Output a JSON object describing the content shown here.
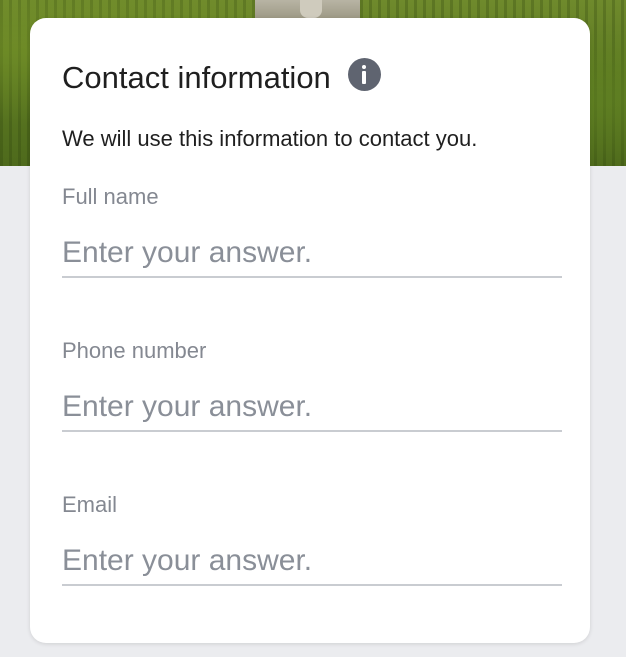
{
  "form": {
    "section_title": "Contact information",
    "info_icon": "info-icon",
    "description": "We will use this information to contact you.",
    "fields": [
      {
        "label": "Full name",
        "placeholder": "Enter your answer.",
        "value": ""
      },
      {
        "label": "Phone number",
        "placeholder": "Enter your answer.",
        "value": ""
      },
      {
        "label": "Email",
        "placeholder": "Enter your answer.",
        "value": ""
      }
    ]
  },
  "colors": {
    "page_background": "#ebecef",
    "card_background": "#ffffff",
    "title_text": "#1f1f1f",
    "label_text": "#848891",
    "placeholder_text": "#8a8f98",
    "underline": "#c9ccd1",
    "info_icon": "#5f6470"
  }
}
